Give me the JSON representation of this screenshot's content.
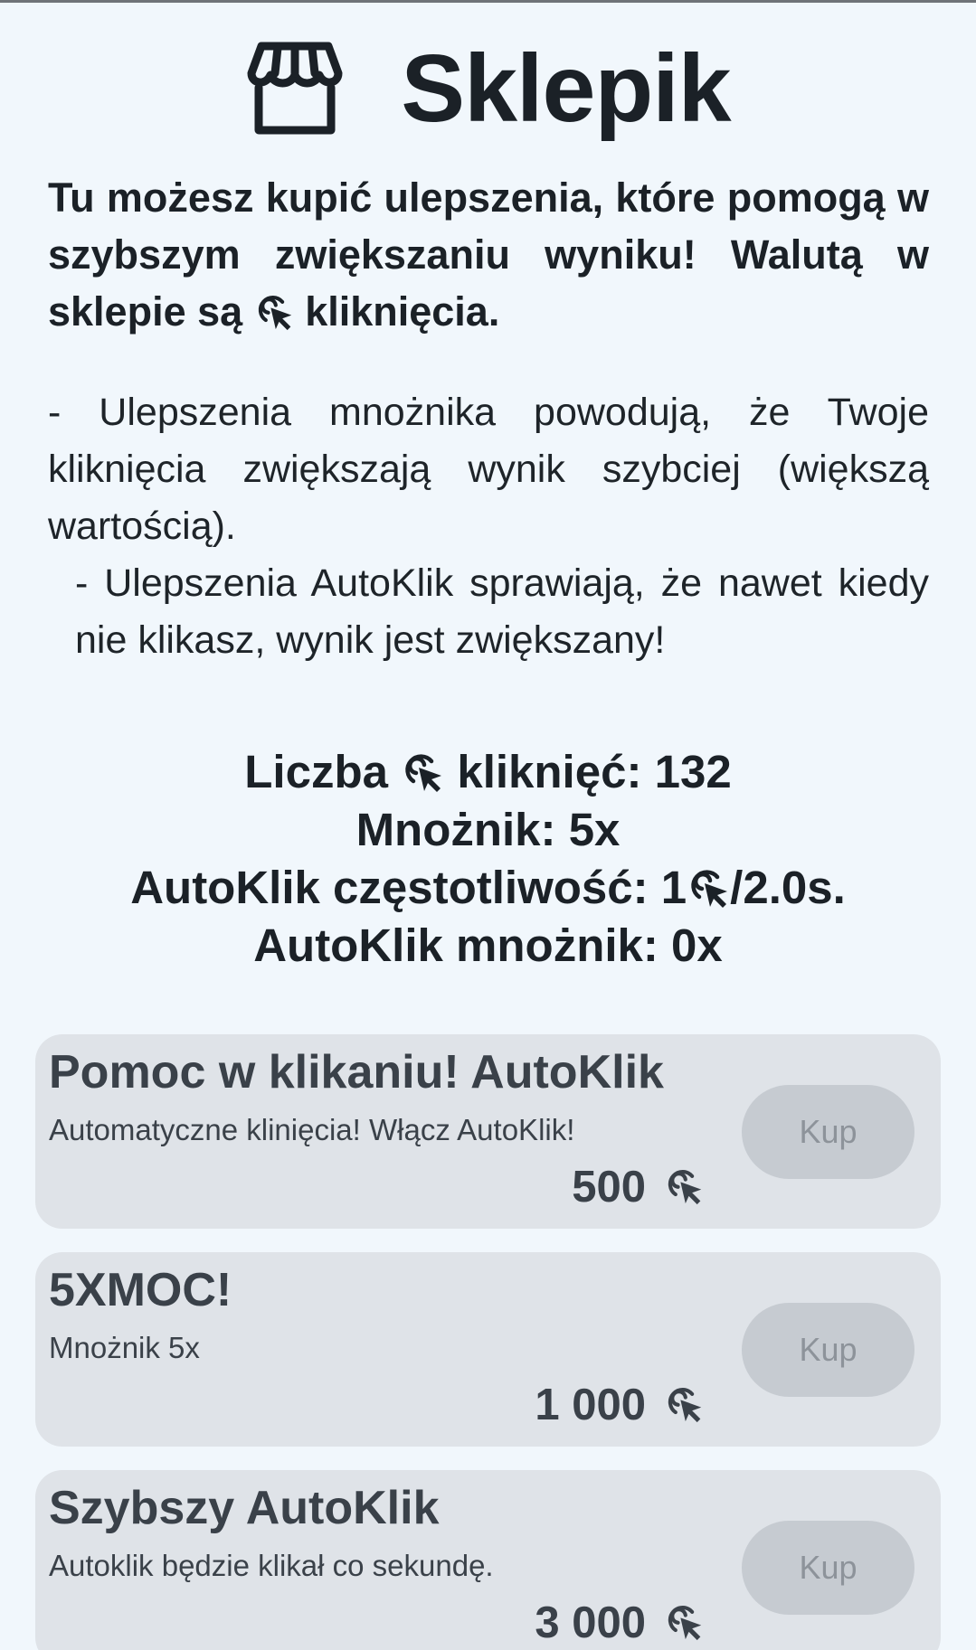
{
  "header": {
    "title": "Sklepik",
    "icon": "storefront-icon"
  },
  "intro": {
    "part1": "Tu możesz kupić ulepszenia, które pomogą w szybszym zwiększaniu wyniku! Walutą w sklepie są",
    "part2": "kliknięcia."
  },
  "description": {
    "line1": "- Ulepszenia mnożnika powodują, że Twoje kliknięcia zwiększają wynik szybciej (większą wartością).",
    "line2": "- Ulepszenia AutoKlik sprawiają, że nawet kiedy nie klikasz, wynik jest zwiększany!"
  },
  "stats": {
    "clicks_prefix": "Liczba",
    "clicks_suffix": "kliknięć: 132",
    "multiplier": "Mnożnik: 5x",
    "autoclick_freq_prefix": "AutoKlik częstotliwość: 1",
    "autoclick_freq_suffix": "/2.0s.",
    "autoclick_multiplier": "AutoKlik mnożnik: 0x"
  },
  "currency_icon": "click-cursor-icon",
  "items": [
    {
      "name": "Pomoc w klikaniu! AutoKlik",
      "description": "Automatyczne klinięcia! Włącz AutoKlik!",
      "price": "500",
      "buy_label": "Kup"
    },
    {
      "name": "5XMOC!",
      "description": "Mnożnik 5x",
      "price": "1 000",
      "buy_label": "Kup"
    },
    {
      "name": "Szybszy AutoKlik",
      "description": "Autoklik będzie klikał co sekundę.",
      "price": "3 000",
      "buy_label": "Kup"
    }
  ],
  "colors": {
    "background": "#f1f7fc",
    "card": "#dfe3e8",
    "button": "#c6cbd1",
    "text": "#1b2127"
  }
}
